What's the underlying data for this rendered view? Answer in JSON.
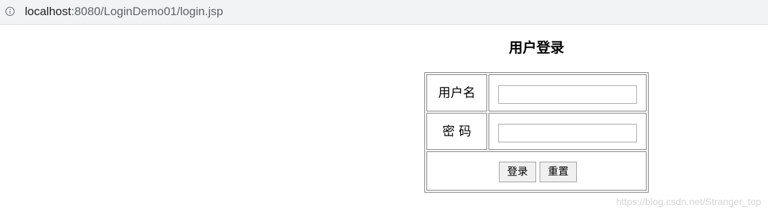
{
  "browser": {
    "url_host": "localhost",
    "url_rest": ":8080/LoginDemo01/login.jsp",
    "info_icon": "info-circle-icon"
  },
  "page": {
    "title": "用户登录"
  },
  "form": {
    "username_label": "用户名",
    "username_value": "",
    "password_label": "密 码",
    "password_value": "",
    "login_button": "登录",
    "reset_button": "重置"
  },
  "watermark": "https://blog.csdn.net/Stranger_top"
}
